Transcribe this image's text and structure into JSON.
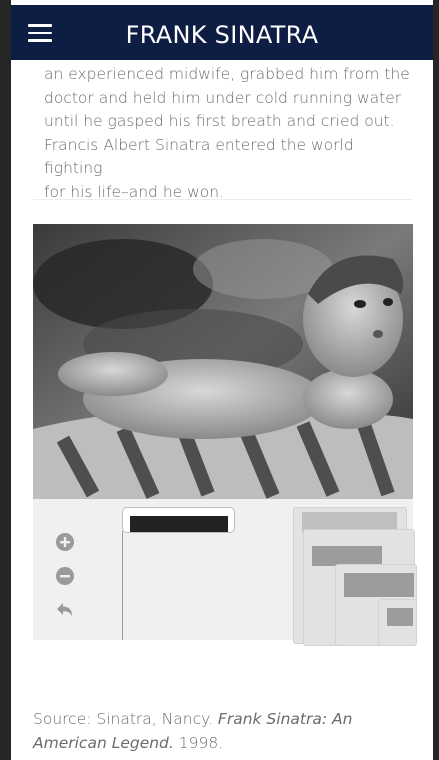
{
  "header": {
    "title": "FRANK SINATRA"
  },
  "article": {
    "paragraph_lines": [
      "an experienced midwife, grabbed him from the",
      "doctor and held him under cold running water",
      "until he gasped his first breath and cried out.",
      "Francis Albert Sinatra entered the world fighting",
      "for his life–and he won."
    ]
  },
  "viewer": {
    "photo_label": "baby-photo",
    "controls": [
      {
        "name": "zoom-in-icon",
        "glyph": "plus-circle"
      },
      {
        "name": "zoom-out-icon",
        "glyph": "minus-circle"
      },
      {
        "name": "reset-icon",
        "glyph": "back-arrow"
      }
    ]
  },
  "caption": {
    "prefix": "Source: Sinatra, Nancy. ",
    "title_italic": "Frank Sinatra: An American Legend.",
    "suffix": " 1998."
  },
  "colors": {
    "header_bg": "#0e1d44",
    "text": "#6e6e6e"
  }
}
